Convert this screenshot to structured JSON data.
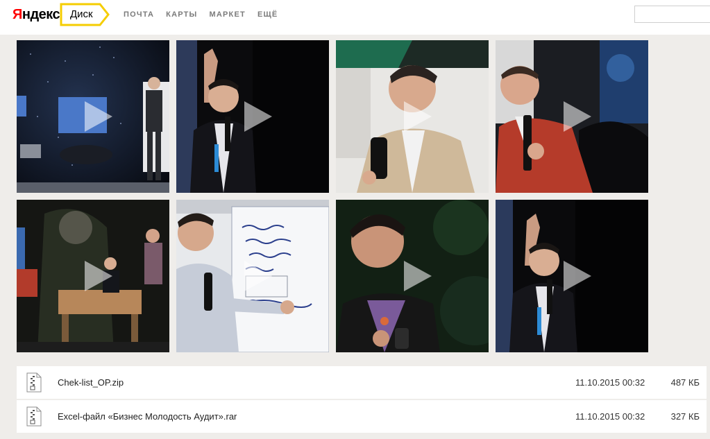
{
  "header": {
    "logo": "Яндекс",
    "logo_first_letter": "Я",
    "logo_rest": "ндекс",
    "service_badge": "Диск",
    "nav": [
      "ПОЧТА",
      "КАРТЫ",
      "МАРКЕТ",
      "ЕЩЁ"
    ],
    "search_placeholder": ""
  },
  "colors": {
    "badge_border": "#f5cd00",
    "logo_red": "#ff0000",
    "page_bg": "#efedea"
  },
  "videos": [
    {
      "scene": "stage-dark-speaker"
    },
    {
      "scene": "speaker-raised-hand"
    },
    {
      "scene": "speaker-microphone-beige"
    },
    {
      "scene": "speaker-red-sweater"
    },
    {
      "scene": "stage-overlay"
    },
    {
      "scene": "flipchart-writing"
    },
    {
      "scene": "speaker-looking-up"
    },
    {
      "scene": "speaker-raised-hand-2"
    }
  ],
  "files": [
    {
      "name": "Chek-list_OP.zip",
      "date": "11.10.2015 00:32",
      "size": "487 КБ",
      "icon": "zip-archive-icon"
    },
    {
      "name": "Excel-файл «Бизнес Молодость Аудит».rar",
      "date": "11.10.2015 00:32",
      "size": "327 КБ",
      "icon": "zip-archive-icon"
    }
  ]
}
